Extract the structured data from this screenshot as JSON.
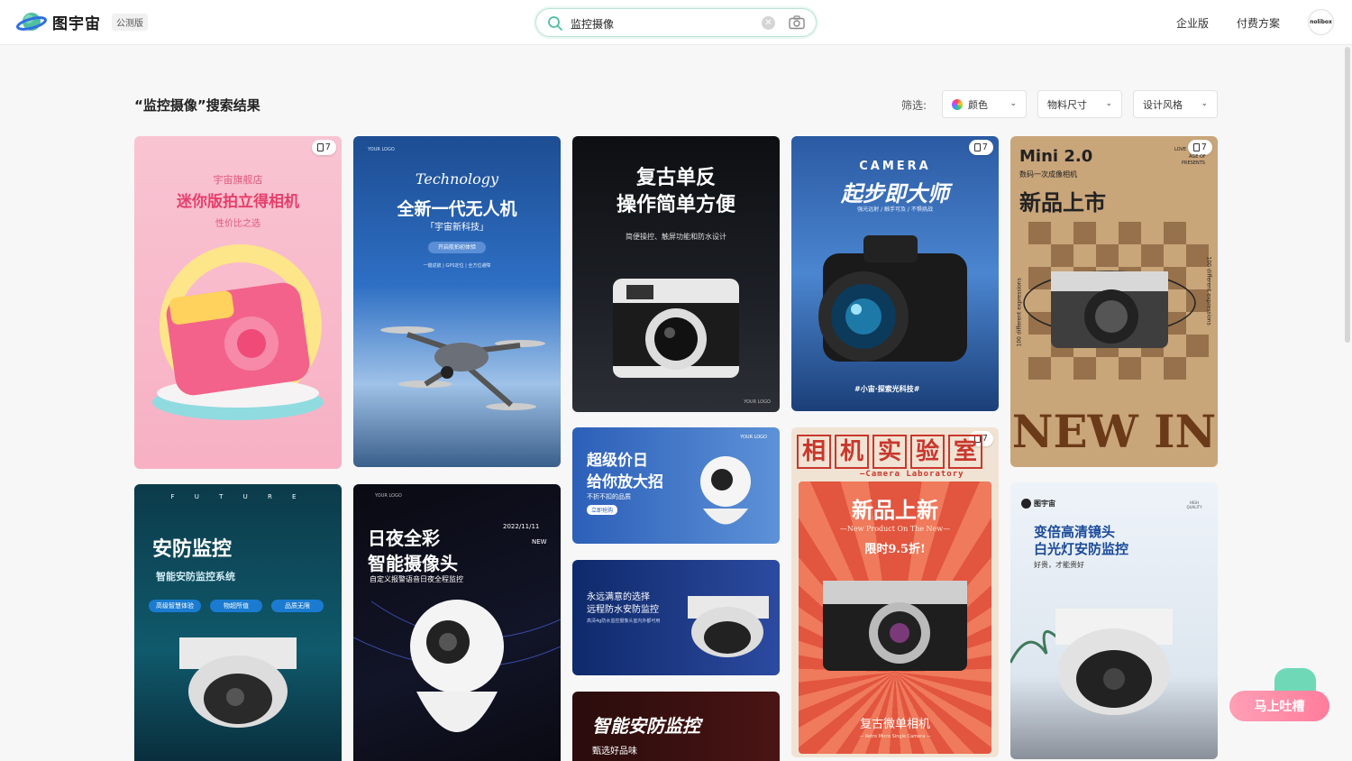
{
  "header": {
    "brand": "图宇宙",
    "beta_badge": "公测版",
    "search_value": "监控摄像",
    "nav": [
      "企业版",
      "付费方案"
    ],
    "avatar_text": "nolibox"
  },
  "results": {
    "title": "“监控摄像”搜索结果",
    "filter_label": "筛选:",
    "filters": [
      "颜色",
      "物料尺寸",
      "设计风格"
    ]
  },
  "cards": {
    "c1": {
      "badge": "7",
      "shop": "宇宙旗舰店",
      "title": "迷你版拍立得相机",
      "sub": "性价比之选"
    },
    "c2": {
      "logo": "YOUR LOGO",
      "script": "Technology",
      "title": "全新一代无人机",
      "brand": "「宇宙新科技」",
      "pill": "开启航拍初体验",
      "features": "一键返航 | GPS定位 | 全方位避障"
    },
    "c3": {
      "title1": "复古单反",
      "title2": "操作简单方便",
      "sub": "简便操控、触屏功能和防水设计",
      "logo": "YOUR LOGO"
    },
    "c4": {
      "badge": "7",
      "brand": "CAMERA",
      "title": "起步即大师",
      "sub": "强光远射 / 触手可及 / 不惧挑战",
      "foot": "#小宙·探索光科技#"
    },
    "c5": {
      "badge": "7",
      "title": "Mini 2.0",
      "sub": "数码一次成像相机",
      "tag1": "LOVE",
      "tag2": "AGE OF",
      "tag3": "PRESENTS",
      "headline": "新品上市",
      "side": "100 different expressions",
      "big": "NEW IN"
    },
    "c6": {
      "letters": "F U T U R E",
      "title": "安防监控",
      "sub": "智能安防监控系统",
      "chips": [
        "高级智慧体验",
        "物超所值",
        "品质无限"
      ]
    },
    "c7": {
      "logo": "YOUR LOGO",
      "title1": "日夜全彩",
      "title2": "智能摄像头",
      "date": "2022/11/11",
      "new": "NEW",
      "sub": "自定义报警语音日夜全程监控"
    },
    "c8": {
      "logo": "YOUR LOGO",
      "title1": "超级价日",
      "title2": "给你放大招",
      "sub": "不折不扣的品质",
      "btn": "立即抢购"
    },
    "c9": {
      "title1": "永远满意的选择",
      "title2": "远程防水安防监控",
      "sub": "高清4g防水监控摄像头室内外都可用"
    },
    "c10": {
      "title": "智能安防监控",
      "sub": "甄选好品味"
    },
    "c11": {
      "badge": "7",
      "chars": [
        "相",
        "机",
        "实",
        "验",
        "室"
      ],
      "lab": "—Camera Laboratory",
      "title": "新品上新",
      "en": "—New Product On The New—",
      "offer": "限时9.5折!",
      "foot": "复古微单相机",
      "foot_en": "— Retro Micro Single Camera —"
    },
    "c12": {
      "brand": "图宇宙",
      "hq": "HIGH QUALITY",
      "title1": "变倍高清镜头",
      "title2": "白光灯安防监控",
      "sub": "好贵，才能贵好"
    }
  },
  "feedback": {
    "label": "马上吐槽"
  },
  "colors": {
    "accent": "#4fbfa0",
    "brand_blue": "#2f6fe0"
  }
}
